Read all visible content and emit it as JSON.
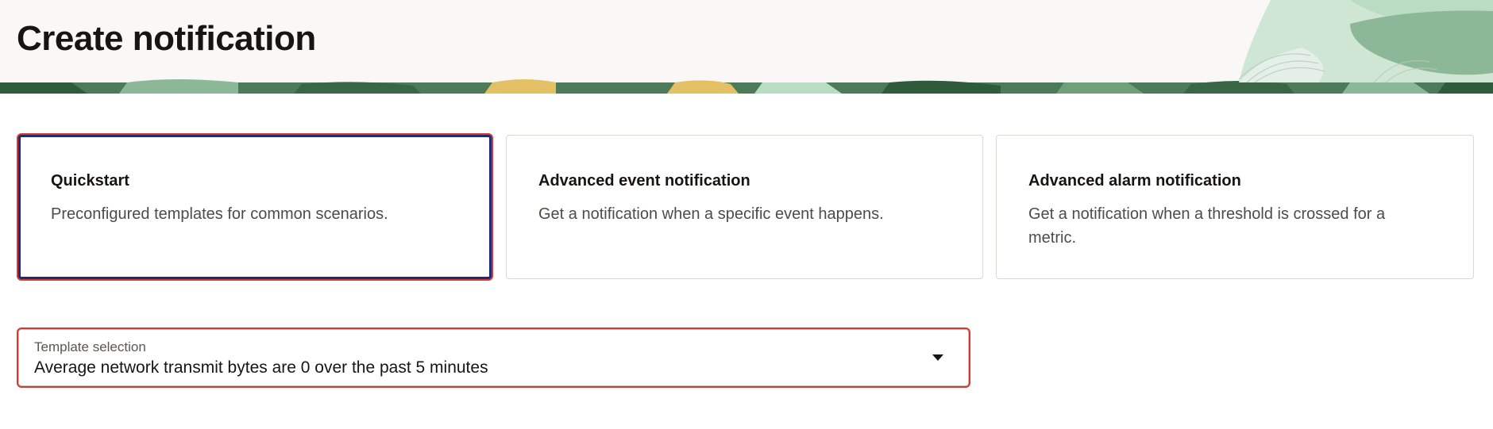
{
  "page": {
    "title": "Create notification"
  },
  "banner": {
    "colors": {
      "dark": "#3e6b4a",
      "mid": "#6fa07c",
      "light": "#b9dcc3",
      "yellow": "#e3c064",
      "bg": "#f9f8f6"
    }
  },
  "cards": [
    {
      "title": "Quickstart",
      "description": "Preconfigured templates for common scenarios.",
      "selected": true
    },
    {
      "title": "Advanced event notification",
      "description": "Get a notification when a specific event happens.",
      "selected": false
    },
    {
      "title": "Advanced alarm notification",
      "description": "Get a notification when a threshold is crossed for a metric.",
      "selected": false
    }
  ],
  "template_select": {
    "label": "Template selection",
    "value": "Average network transmit bytes are 0 over the past 5 minutes",
    "icon": "chevron-down-icon"
  },
  "colors": {
    "accent_border": "#1f2a78",
    "highlight": "#d23a33",
    "text": "#161513",
    "muted": "#4f4b46"
  }
}
